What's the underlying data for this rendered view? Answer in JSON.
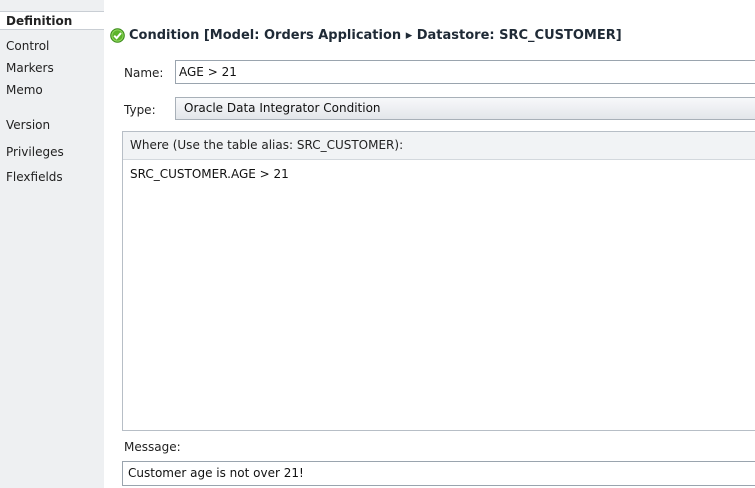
{
  "sidebar": {
    "items": [
      {
        "label": "Definition"
      },
      {
        "label": "Control"
      },
      {
        "label": "Markers"
      },
      {
        "label": "Memo"
      },
      {
        "label": "Version"
      },
      {
        "label": "Privileges"
      },
      {
        "label": "Flexfields"
      }
    ]
  },
  "header": {
    "icon": "check-icon",
    "title": "Condition [Model: Orders Application ▸ Datastore: SRC_CUSTOMER]"
  },
  "form": {
    "name_label": "Name:",
    "name_value": "AGE > 21",
    "type_label": "Type:",
    "type_value": "Oracle Data Integrator Condition",
    "where_label": "Where (Use the table alias: SRC_CUSTOMER):",
    "where_value": "SRC_CUSTOMER.AGE > 21",
    "message_label": "Message:",
    "message_value": "Customer age is not over 21!"
  },
  "colors": {
    "sidebar_bg": "#eef0f2",
    "accent_green": "#5cb32b"
  }
}
